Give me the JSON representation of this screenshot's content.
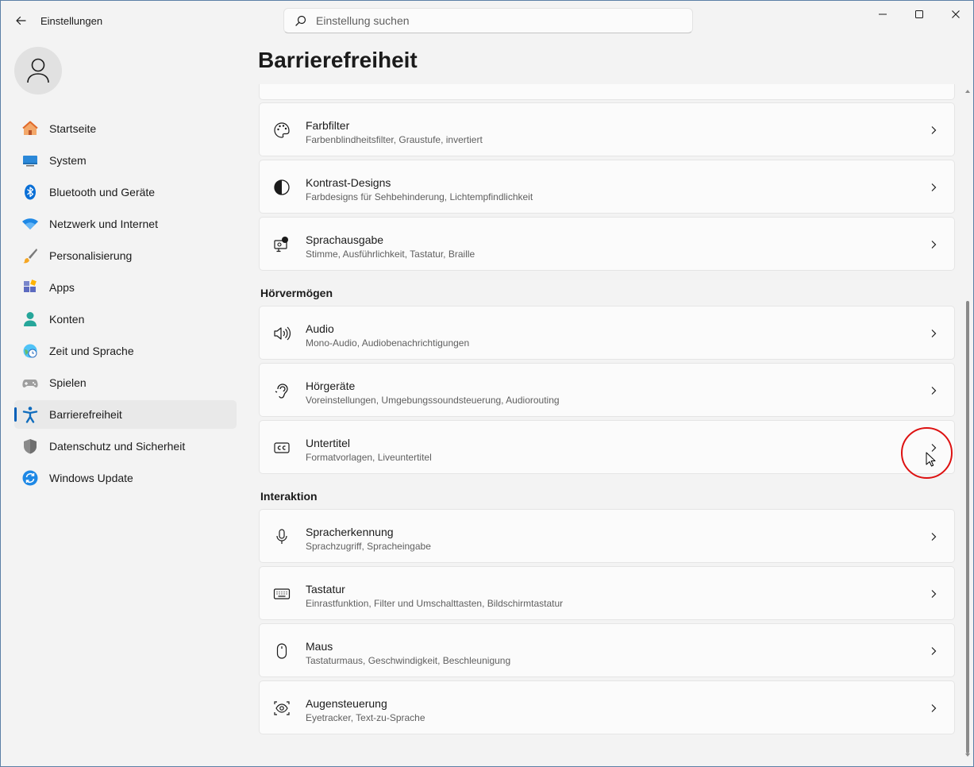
{
  "window": {
    "app_title": "Einstellungen",
    "search_placeholder": "Einstellung suchen"
  },
  "sidebar": {
    "items": [
      {
        "label": "Startseite",
        "icon": "home-icon"
      },
      {
        "label": "System",
        "icon": "monitor-icon"
      },
      {
        "label": "Bluetooth und Geräte",
        "icon": "bluetooth-icon"
      },
      {
        "label": "Netzwerk und Internet",
        "icon": "wifi-icon"
      },
      {
        "label": "Personalisierung",
        "icon": "brush-icon"
      },
      {
        "label": "Apps",
        "icon": "apps-icon"
      },
      {
        "label": "Konten",
        "icon": "person-icon"
      },
      {
        "label": "Zeit und Sprache",
        "icon": "clock-globe-icon"
      },
      {
        "label": "Spielen",
        "icon": "gamepad-icon"
      },
      {
        "label": "Barrierefreiheit",
        "icon": "accessibility-icon",
        "active": true
      },
      {
        "label": "Datenschutz und Sicherheit",
        "icon": "shield-icon"
      },
      {
        "label": "Windows Update",
        "icon": "update-icon"
      }
    ]
  },
  "main": {
    "page_title": "Barrierefreiheit",
    "cards": [
      {
        "title": "Farbfilter",
        "subtitle": "Farbenblindheitsfilter, Graustufe, invertiert",
        "icon": "palette-icon"
      },
      {
        "title": "Kontrast-Designs",
        "subtitle": "Farbdesigns für Sehbehinderung, Lichtempfindlichkeit",
        "icon": "contrast-icon"
      },
      {
        "title": "Sprachausgabe",
        "subtitle": "Stimme, Ausführlichkeit, Tastatur, Braille",
        "icon": "narrator-icon"
      },
      {
        "title": "Audio",
        "subtitle": "Mono-Audio, Audiobenachrichtigungen",
        "icon": "speaker-icon"
      },
      {
        "title": "Hörgeräte",
        "subtitle": "Voreinstellungen, Umgebungssoundsteuerung, Audiorouting",
        "icon": "ear-icon"
      },
      {
        "title": "Untertitel",
        "subtitle": "Formatvorlagen, Liveuntertitel",
        "icon": "captions-icon"
      },
      {
        "title": "Spracherkennung",
        "subtitle": "Sprachzugriff, Spracheingabe",
        "icon": "microphone-icon"
      },
      {
        "title": "Tastatur",
        "subtitle": "Einrastfunktion, Filter und Umschalttasten, Bildschirmtastatur",
        "icon": "keyboard-icon"
      },
      {
        "title": "Maus",
        "subtitle": "Tastaturmaus, Geschwindigkeit, Beschleunigung",
        "icon": "mouse-icon"
      },
      {
        "title": "Augensteuerung",
        "subtitle": "Eyetracker, Text-zu-Sprache",
        "icon": "eye-control-icon"
      }
    ],
    "sections": {
      "hearing": "Hörvermögen",
      "interaction": "Interaktion"
    }
  }
}
